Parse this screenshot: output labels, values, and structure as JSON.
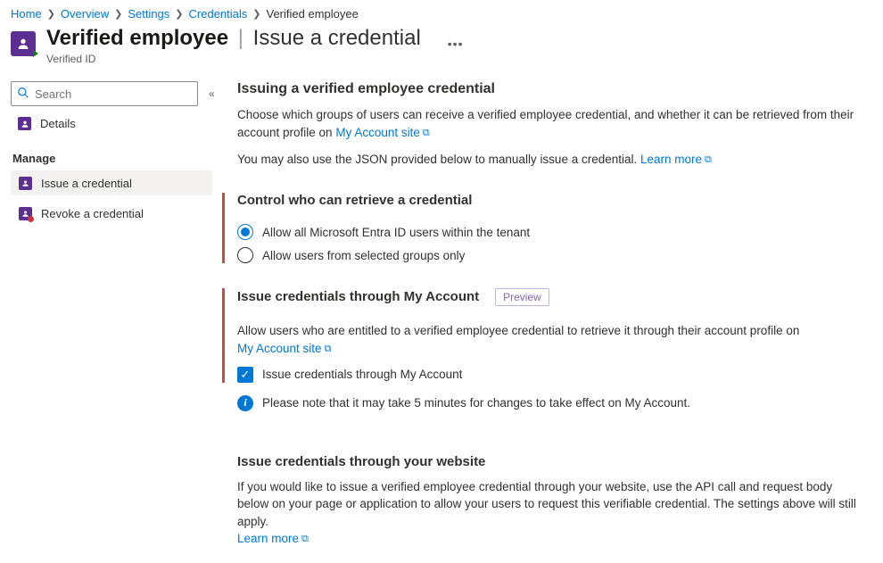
{
  "breadcrumb": {
    "items": [
      "Home",
      "Overview",
      "Settings",
      "Credentials"
    ],
    "current": "Verified employee"
  },
  "header": {
    "title": "Verified employee",
    "subtitle_page": "Issue a credential",
    "product": "Verified ID"
  },
  "sidebar": {
    "search_placeholder": "Search",
    "details": "Details",
    "manage_label": "Manage",
    "issue": "Issue a credential",
    "revoke": "Revoke a credential"
  },
  "main": {
    "h_issuing": "Issuing a verified employee credential",
    "p_choose": "Choose which groups of users can receive a verified employee credential, and whether it can be retrieved from their account profile on ",
    "link_myaccount": "My Account site",
    "p_json": "You may also use the JSON provided below to manually issue a credential. ",
    "link_learnmore": "Learn more",
    "h_control": "Control who can retrieve a credential",
    "radio_all": "Allow all Microsoft Entra ID users within the tenant",
    "radio_selected": "Allow users from selected groups only",
    "h_myaccount": "Issue credentials through My Account",
    "badge_preview": "Preview",
    "p_entitled": "Allow users who are entitled to a verified employee credential to retrieve it through their account profile on",
    "check_label": "Issue credentials through My Account",
    "info_note": "Please note that it may take 5 minutes for changes to take effect on My Account.",
    "h_website": "Issue credentials through your website",
    "p_website": "If you would like to issue a verified employee credential through your website, use the API call and request body below on your page or application to allow your users to request this verifiable credential. The settings above will still apply."
  }
}
